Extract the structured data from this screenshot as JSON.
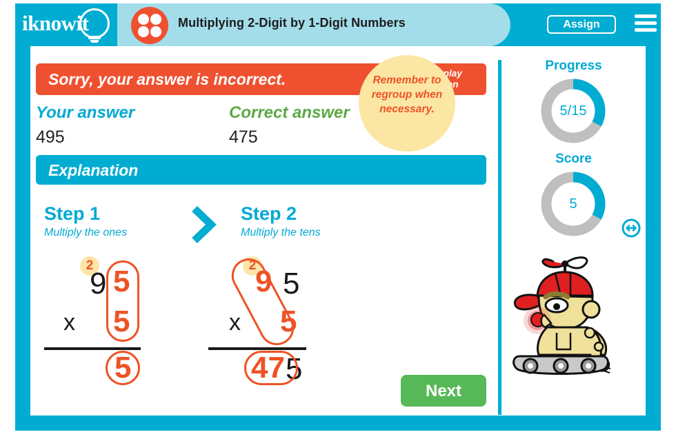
{
  "header": {
    "logo_text": "iknowit",
    "logo_icon": "lightbulb-icon",
    "badge_icon": "four-dots-icon",
    "title": "Multiplying 2-Digit by 1-Digit Numbers",
    "assign_label": "Assign",
    "menu_icon": "hamburger-menu-icon"
  },
  "feedback": {
    "banner_text": "Sorry, your answer is incorrect.",
    "redisplay_line1": "Redisplay",
    "redisplay_line2": "Question",
    "your_answer_label": "Your answer",
    "your_answer_value": "495",
    "correct_answer_label": "Correct answer",
    "correct_answer_value": "475"
  },
  "explanation": {
    "heading": "Explanation",
    "chevron_icon": "chevron-right-icon",
    "step1": {
      "title": "Step 1",
      "subtitle": "Multiply the ones",
      "carry": "2",
      "top_tens": "9",
      "top_ones": "5",
      "times_sign": "x",
      "multiplier": "5",
      "product_ones": "5"
    },
    "step2": {
      "title": "Step 2",
      "subtitle": "Multiply the tens",
      "carry": "2",
      "top_tens": "9",
      "top_ones": "5",
      "times_sign": "x",
      "multiplier": "5",
      "product_tens": "47",
      "product_ones": "5"
    },
    "hint": "Remember to regroup when necessary."
  },
  "actions": {
    "next_label": "Next"
  },
  "sidebar": {
    "progress_label": "Progress",
    "progress_value": "5/15",
    "progress_percent": 33,
    "score_label": "Score",
    "score_value": "5",
    "score_percent": 33,
    "mascot_icon": "robot-mascot-icon",
    "swap_icon": "swap-arrows-icon"
  },
  "colors": {
    "brand_blue": "#00ACD2",
    "light_blue_panel": "#A3DDEA",
    "error_red": "#EF5130",
    "correct_green": "#5CA845",
    "next_green": "#57B857",
    "accent_orange": "#EE5326",
    "hint_yellow": "#FBE6A4",
    "donut_track": "#BFBFBF"
  }
}
